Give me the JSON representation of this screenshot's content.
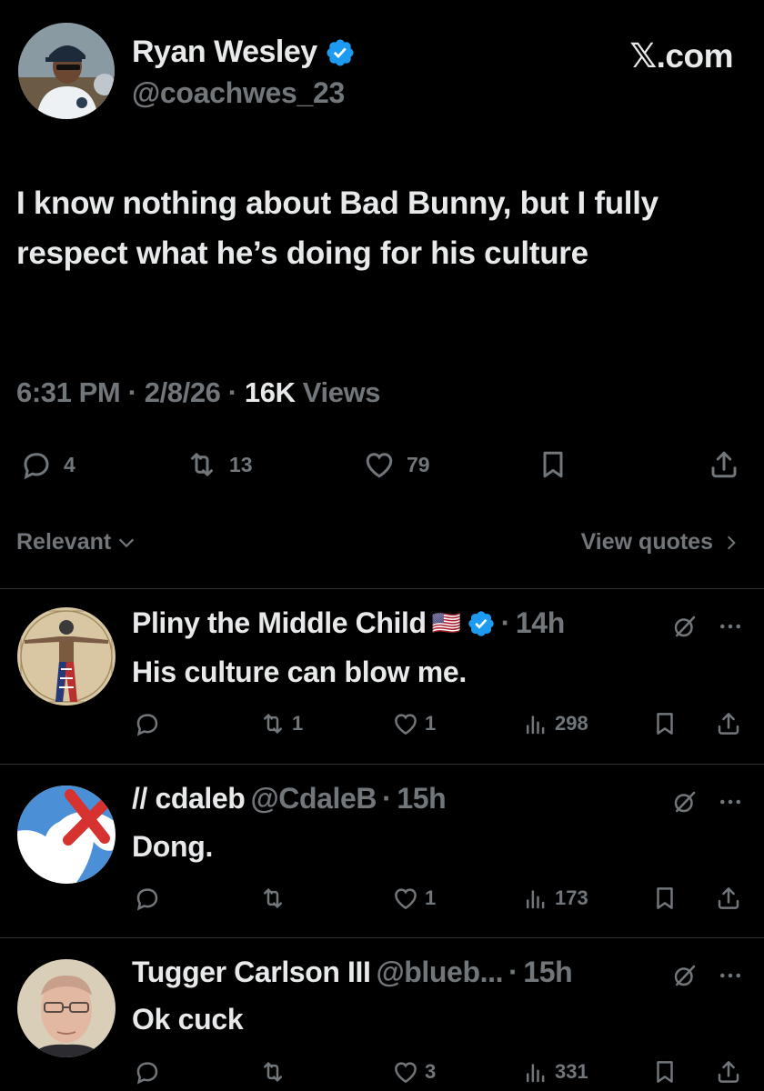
{
  "post": {
    "author_name": "Ryan Wesley",
    "author_handle": "@coachwes_23",
    "site": "𝕏.com",
    "text": "I know nothing about Bad Bunny, but I fully respect what he’s doing for his culture",
    "time": "6:31 PM",
    "date": "2/8/26",
    "views_count": "16K",
    "views_label": "Views",
    "separator": "·",
    "replies": "4",
    "reposts": "13",
    "likes": "79"
  },
  "sort": {
    "label": "Relevant",
    "view_quotes": "View quotes"
  },
  "replies": [
    {
      "name": "Pliny the Middle Child",
      "flag": "🇺🇸",
      "handle": "",
      "separator": "·",
      "time": "14h",
      "text": "His culture can blow me.",
      "reposts": "1",
      "likes": "1",
      "views": "298",
      "verified": true
    },
    {
      "name": "// cdaleb",
      "handle": "@CdaleB",
      "separator": "·",
      "time": "15h",
      "text": "Dong.",
      "reposts": "",
      "likes": "1",
      "views": "173",
      "verified": false
    },
    {
      "name": "Tugger Carlson III",
      "handle": "@blueb...",
      "separator": "·",
      "time": "15h",
      "text": "Ok cuck",
      "reposts": "",
      "likes": "3",
      "views": "331",
      "verified": false
    }
  ],
  "colors": {
    "background": "#000000",
    "text": "#e7e9ea",
    "muted": "#71767b",
    "verified": "#1d9bf0",
    "divider": "#2f3336"
  },
  "icons": [
    "verified-badge-icon",
    "reply-icon",
    "repost-icon",
    "like-icon",
    "bookmark-icon",
    "share-icon",
    "views-icon",
    "grok-icon",
    "more-icon",
    "chevron-down-icon",
    "chevron-right-icon"
  ]
}
